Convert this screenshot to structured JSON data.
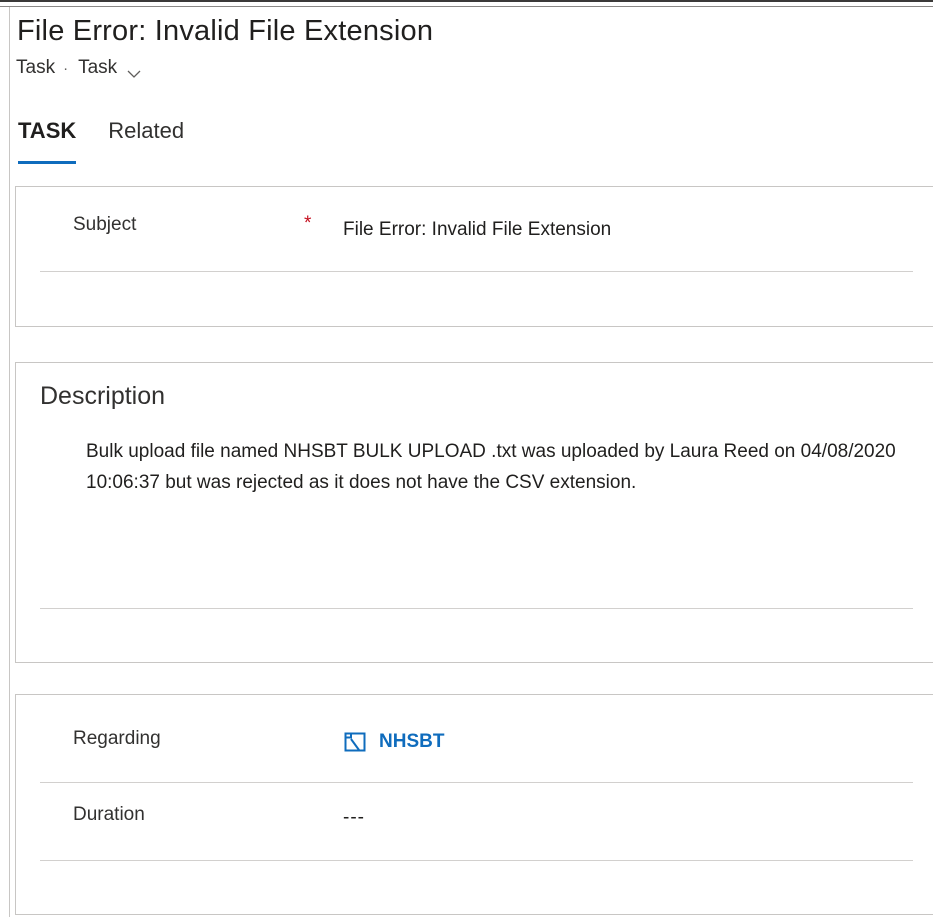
{
  "header": {
    "title": "File Error: Invalid File Extension",
    "breadcrumb": {
      "entity": "Task",
      "separator": "·",
      "form_selector": "Task"
    }
  },
  "tabs": [
    {
      "label": "TASK",
      "active": true
    },
    {
      "label": "Related",
      "active": false
    }
  ],
  "general_section": {
    "subject_label": "Subject",
    "subject_required_marker": "*",
    "subject_value": "File Error: Invalid File Extension"
  },
  "description_section": {
    "title": "Description",
    "text": "Bulk upload file named NHSBT BULK UPLOAD .txt was uploaded by Laura Reed on 04/08/2020 10:06:37 but was rejected as it does not have the CSV extension."
  },
  "details_section": {
    "regarding_label": "Regarding",
    "regarding_value": "NHSBT",
    "regarding_icon": "account-record-icon",
    "duration_label": "Duration",
    "duration_value": "---"
  },
  "colors": {
    "accent": "#0f6cbd",
    "required": "#c50f1f",
    "border": "#c8c6c4",
    "text": "#201f1e"
  }
}
